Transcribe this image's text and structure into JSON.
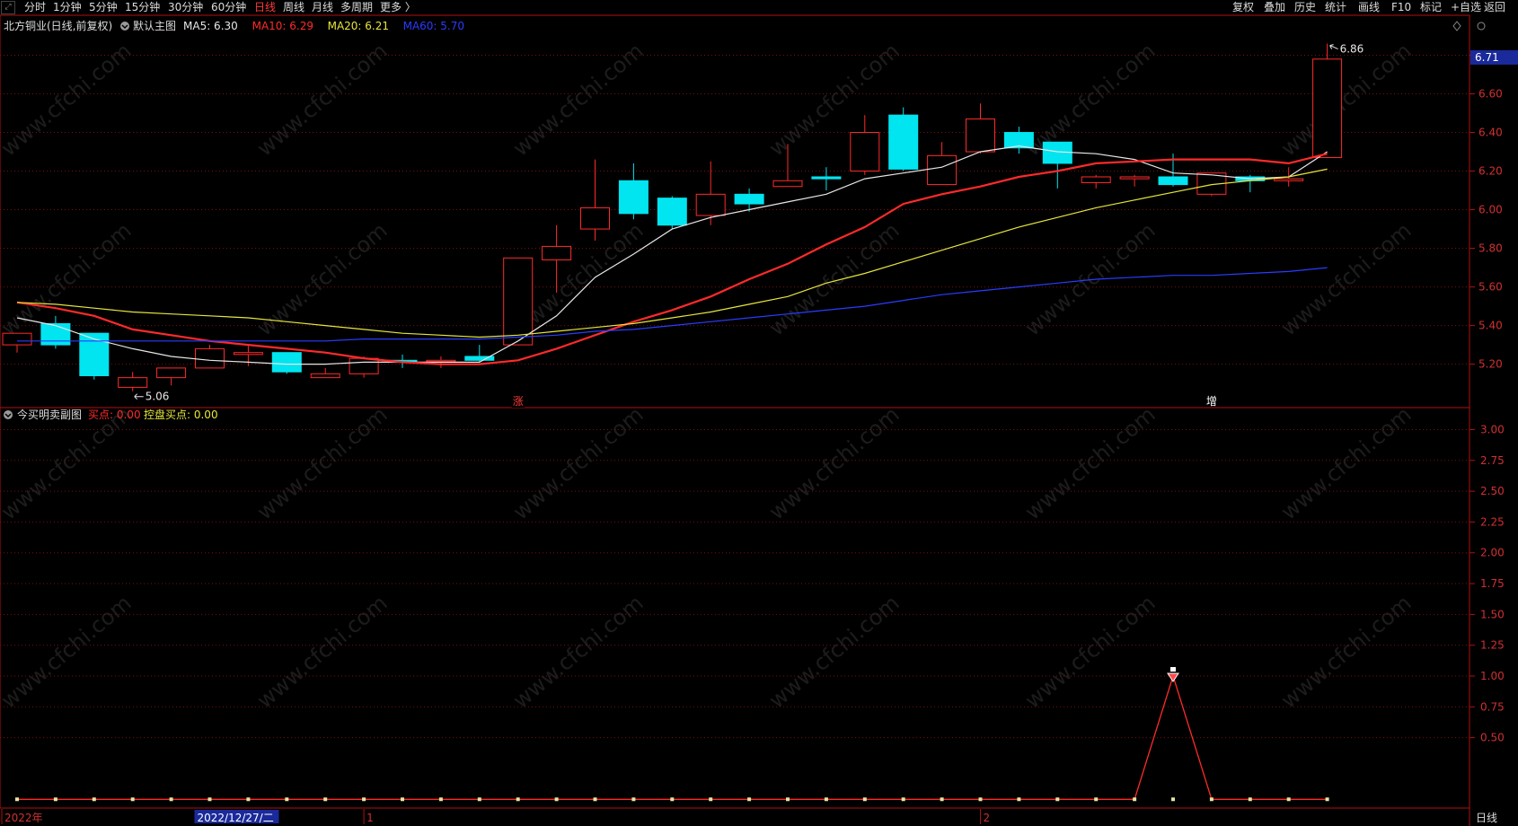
{
  "toolbar": {
    "periods": [
      {
        "label": "分时",
        "active": false
      },
      {
        "label": "1分钟",
        "active": false
      },
      {
        "label": "5分钟",
        "active": false
      },
      {
        "label": "15分钟",
        "active": false
      },
      {
        "label": "30分钟",
        "active": false
      },
      {
        "label": "60分钟",
        "active": false
      },
      {
        "label": "日线",
        "active": true
      },
      {
        "label": "周线",
        "active": false
      },
      {
        "label": "月线",
        "active": false
      },
      {
        "label": "多周期",
        "active": false
      },
      {
        "label": "更多 〉",
        "active": false
      }
    ],
    "right_buttons": [
      "复权",
      "叠加",
      "历史",
      "统计",
      "画线",
      "F10",
      "标记",
      "+自选",
      "返回"
    ]
  },
  "main_panel": {
    "stock_title": "北方铜业(日线,前复权)",
    "indicator_name": "默认主图",
    "legend": [
      {
        "label": "MA5: 6.30",
        "color": "#e6e6e6"
      },
      {
        "label": "MA10: 6.29",
        "color": "#ff2a2a"
      },
      {
        "label": "MA20: 6.21",
        "color": "#e6e63c"
      },
      {
        "label": "MA60: 5.70",
        "color": "#2a3cff"
      }
    ],
    "last_price_tag": "6.71",
    "high_label": "6.86",
    "low_label": "5.06",
    "marker_zhang": "涨",
    "marker_zeng": "增"
  },
  "sub_panel": {
    "indicator_name": "今买明卖副图",
    "legend": [
      {
        "label": "买点: 0.00",
        "color": "#ff2a2a"
      },
      {
        "label": "控盘买点: 0.00",
        "color": "#e6e63c"
      }
    ]
  },
  "x_axis_labels": [
    {
      "text": "2022年",
      "bar": 0,
      "highlight": false
    },
    {
      "text": "2022/12/27/二",
      "bar": 5,
      "highlight": true
    },
    {
      "text": "1",
      "bar": 9,
      "highlight": false
    },
    {
      "text": "2",
      "bar": 25,
      "highlight": false
    }
  ],
  "period_tag": "日线",
  "watermark": "www.cfchi.com",
  "colors": {
    "up": "#ff2a2a",
    "down": "#00e5f0",
    "ma5": "#e6e6e6",
    "ma10": "#ff2a2a",
    "ma20": "#e6e63c",
    "ma60": "#2a3cff",
    "panel_border": "#b01010",
    "grid": "#7a1010"
  },
  "chart_data": [
    {
      "type": "candlestick",
      "title": "北方铜业(日线,前复权)",
      "y_ticks": [
        5.2,
        5.4,
        5.6,
        5.8,
        6.0,
        6.2,
        6.4,
        6.6,
        6.8
      ],
      "ylim": [
        5.04,
        6.9
      ],
      "candles": [
        {
          "o": 5.3,
          "h": 5.36,
          "l": 5.26,
          "c": 5.36
        },
        {
          "o": 5.41,
          "h": 5.45,
          "l": 5.28,
          "c": 5.3
        },
        {
          "o": 5.36,
          "h": 5.36,
          "l": 5.12,
          "c": 5.14
        },
        {
          "o": 5.08,
          "h": 5.16,
          "l": 5.06,
          "c": 5.13
        },
        {
          "o": 5.13,
          "h": 5.18,
          "l": 5.09,
          "c": 5.18
        },
        {
          "o": 5.18,
          "h": 5.3,
          "l": 5.18,
          "c": 5.28
        },
        {
          "o": 5.25,
          "h": 5.3,
          "l": 5.19,
          "c": 5.26
        },
        {
          "o": 5.26,
          "h": 5.26,
          "l": 5.15,
          "c": 5.16
        },
        {
          "o": 5.13,
          "h": 5.18,
          "l": 5.13,
          "c": 5.15
        },
        {
          "o": 5.15,
          "h": 5.24,
          "l": 5.13,
          "c": 5.23
        },
        {
          "o": 5.22,
          "h": 5.25,
          "l": 5.18,
          "c": 5.21
        },
        {
          "o": 5.22,
          "h": 5.24,
          "l": 5.18,
          "c": 5.22
        },
        {
          "o": 5.24,
          "h": 5.3,
          "l": 5.21,
          "c": 5.22
        },
        {
          "o": 5.3,
          "h": 5.75,
          "l": 5.3,
          "c": 5.75
        },
        {
          "o": 5.74,
          "h": 5.92,
          "l": 5.57,
          "c": 5.81
        },
        {
          "o": 5.9,
          "h": 6.26,
          "l": 5.84,
          "c": 6.01
        },
        {
          "o": 6.15,
          "h": 6.24,
          "l": 5.95,
          "c": 5.98
        },
        {
          "o": 6.06,
          "h": 6.07,
          "l": 5.9,
          "c": 5.92
        },
        {
          "o": 5.97,
          "h": 6.25,
          "l": 5.92,
          "c": 6.08
        },
        {
          "o": 6.08,
          "h": 6.11,
          "l": 5.99,
          "c": 6.03
        },
        {
          "o": 6.12,
          "h": 6.34,
          "l": 6.12,
          "c": 6.15
        },
        {
          "o": 6.17,
          "h": 6.22,
          "l": 6.1,
          "c": 6.16
        },
        {
          "o": 6.2,
          "h": 6.49,
          "l": 6.18,
          "c": 6.4
        },
        {
          "o": 6.49,
          "h": 6.53,
          "l": 6.2,
          "c": 6.21
        },
        {
          "o": 6.13,
          "h": 6.35,
          "l": 6.13,
          "c": 6.28
        },
        {
          "o": 6.3,
          "h": 6.55,
          "l": 6.29,
          "c": 6.47
        },
        {
          "o": 6.4,
          "h": 6.43,
          "l": 6.29,
          "c": 6.32
        },
        {
          "o": 6.35,
          "h": 6.35,
          "l": 6.11,
          "c": 6.24
        },
        {
          "o": 6.14,
          "h": 6.18,
          "l": 6.11,
          "c": 6.17
        },
        {
          "o": 6.16,
          "h": 6.18,
          "l": 6.12,
          "c": 6.17
        },
        {
          "o": 6.17,
          "h": 6.29,
          "l": 6.12,
          "c": 6.13
        },
        {
          "o": 6.08,
          "h": 6.19,
          "l": 6.07,
          "c": 6.19
        },
        {
          "o": 6.17,
          "h": 6.18,
          "l": 6.09,
          "c": 6.15
        },
        {
          "o": 6.15,
          "h": 6.22,
          "l": 6.12,
          "c": 6.16
        },
        {
          "o": 6.27,
          "h": 6.86,
          "l": 6.27,
          "c": 6.78
        }
      ],
      "series": [
        {
          "name": "MA5",
          "values": [
            5.44,
            5.4,
            5.33,
            5.28,
            5.24,
            5.22,
            5.21,
            5.2,
            5.2,
            5.21,
            5.21,
            5.21,
            5.21,
            5.32,
            5.45,
            5.65,
            5.77,
            5.9,
            5.96,
            6.0,
            6.04,
            6.08,
            6.16,
            6.19,
            6.22,
            6.3,
            6.33,
            6.3,
            6.29,
            6.26,
            6.19,
            6.18,
            6.16,
            6.17,
            6.3
          ]
        },
        {
          "name": "MA10",
          "values": [
            5.52,
            5.49,
            5.45,
            5.38,
            5.35,
            5.32,
            5.3,
            5.28,
            5.26,
            5.23,
            5.21,
            5.2,
            5.2,
            5.22,
            5.28,
            5.35,
            5.42,
            5.48,
            5.55,
            5.64,
            5.72,
            5.82,
            5.91,
            6.03,
            6.08,
            6.12,
            6.17,
            6.2,
            6.24,
            6.25,
            6.26,
            6.26,
            6.26,
            6.24,
            6.29
          ]
        },
        {
          "name": "MA20",
          "values": [
            5.52,
            5.51,
            5.49,
            5.47,
            5.46,
            5.45,
            5.44,
            5.42,
            5.4,
            5.38,
            5.36,
            5.35,
            5.34,
            5.35,
            5.37,
            5.39,
            5.41,
            5.44,
            5.47,
            5.51,
            5.55,
            5.62,
            5.67,
            5.73,
            5.79,
            5.85,
            5.91,
            5.96,
            6.01,
            6.05,
            6.09,
            6.13,
            6.15,
            6.17,
            6.21
          ]
        },
        {
          "name": "MA60",
          "values": [
            5.32,
            5.32,
            5.32,
            5.32,
            5.32,
            5.32,
            5.32,
            5.32,
            5.32,
            5.33,
            5.33,
            5.33,
            5.33,
            5.34,
            5.35,
            5.37,
            5.38,
            5.4,
            5.42,
            5.44,
            5.46,
            5.48,
            5.5,
            5.53,
            5.56,
            5.58,
            5.6,
            5.62,
            5.64,
            5.65,
            5.66,
            5.66,
            5.67,
            5.68,
            5.7
          ]
        }
      ]
    },
    {
      "type": "line",
      "title": "今买明卖副图",
      "y_ticks": [
        0.5,
        0.75,
        1.0,
        1.25,
        1.5,
        1.75,
        2.0,
        2.25,
        2.5,
        2.75,
        3.0
      ],
      "ylim": [
        -0.02,
        3.12
      ],
      "series": [
        {
          "name": "买点",
          "values": [
            0,
            0,
            0,
            0,
            0,
            0,
            0,
            0,
            0,
            0,
            0,
            0,
            0,
            0,
            0,
            0,
            0,
            0,
            0,
            0,
            0,
            0,
            0,
            0,
            0,
            0,
            0,
            0,
            0,
            0,
            1,
            0,
            0,
            0,
            0
          ]
        },
        {
          "name": "控盘买点",
          "values": [
            0,
            0,
            0,
            0,
            0,
            0,
            0,
            0,
            0,
            0,
            0,
            0,
            0,
            0,
            0,
            0,
            0,
            0,
            0,
            0,
            0,
            0,
            0,
            0,
            0,
            0,
            0,
            0,
            0,
            0,
            0,
            0,
            0,
            0,
            0
          ]
        }
      ]
    }
  ]
}
